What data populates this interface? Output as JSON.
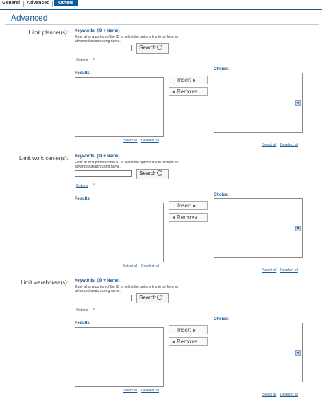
{
  "tabs": [
    {
      "label": "General"
    },
    {
      "label": "Advanced"
    },
    {
      "label": "Others"
    }
  ],
  "page_title": "Advanced",
  "sections": [
    {
      "label": "Limit planner(s):",
      "keywords_label": "Keywords: (ID + Name)",
      "help": "Enter all or a portion of the ID or select the options link to perform an advanced search using name.",
      "search": "Search",
      "options": "Options",
      "results": "Results:",
      "insert": "Insert",
      "remove": "Remove",
      "choice": "Choice:",
      "select_all": "Select all",
      "deselect_all": "Deselect all"
    },
    {
      "label": "Limit work center(s):",
      "keywords_label": "Keywords: (ID + Name)",
      "help": "Enter all or a portion of the ID or select the options link to perform an advanced search using name.",
      "search": "Search",
      "options": "Options",
      "results": "Results:",
      "insert": "Insert",
      "remove": "Remove",
      "choice": "Choice:",
      "select_all": "Select all",
      "deselect_all": "Deselect all"
    },
    {
      "label": "Limit warehouse(s):",
      "keywords_label": "Keywords: (ID + Name)",
      "help": "Enter all or a portion of the ID or select the options link to perform an advanced search using name.",
      "search": "Search",
      "options": "Options",
      "results": "Results:",
      "insert": "Insert",
      "remove": "Remove",
      "choice": "Choice:",
      "select_all": "Select all",
      "deselect_all": "Deselect all"
    }
  ],
  "colors": {
    "accent": "#0a5aa0",
    "link": "#1e5a96",
    "arrow": "#3c8c30"
  }
}
